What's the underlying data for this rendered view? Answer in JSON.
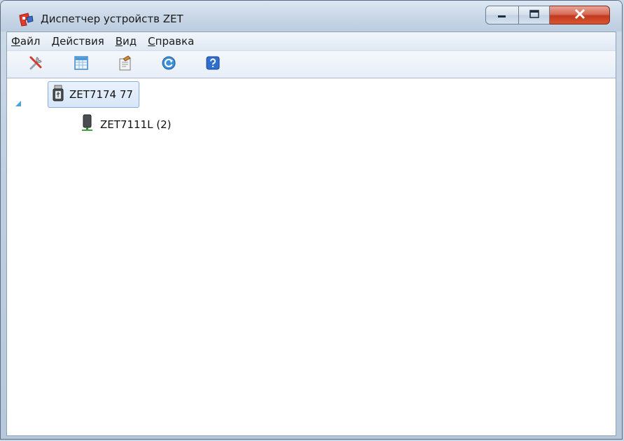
{
  "window": {
    "title": "Диспетчер устройств ZET",
    "caption_buttons": [
      "minimize",
      "maximize",
      "close"
    ]
  },
  "menubar": {
    "items": [
      {
        "accel": "Ф",
        "rest": "айл"
      },
      {
        "accel": "Д",
        "rest": "ействия"
      },
      {
        "accel": "В",
        "rest": "ид"
      },
      {
        "accel": "С",
        "rest": "правка"
      }
    ]
  },
  "toolbar": {
    "buttons": [
      {
        "icon": "tools-icon"
      },
      {
        "icon": "table-icon"
      },
      {
        "icon": "properties-icon"
      },
      {
        "icon": "refresh-icon"
      },
      {
        "icon": "help-icon"
      }
    ]
  },
  "tree": {
    "root": {
      "label": "ZET7174 77",
      "icon": "usb-device-icon",
      "expanded": true,
      "selected": true
    },
    "children": [
      {
        "label": "ZET7111L (2)",
        "icon": "network-device-icon"
      }
    ]
  },
  "colors": {
    "selection_fill": "#d7e6f9",
    "selection_border": "#84acdd",
    "close_button": "#c2391f"
  }
}
